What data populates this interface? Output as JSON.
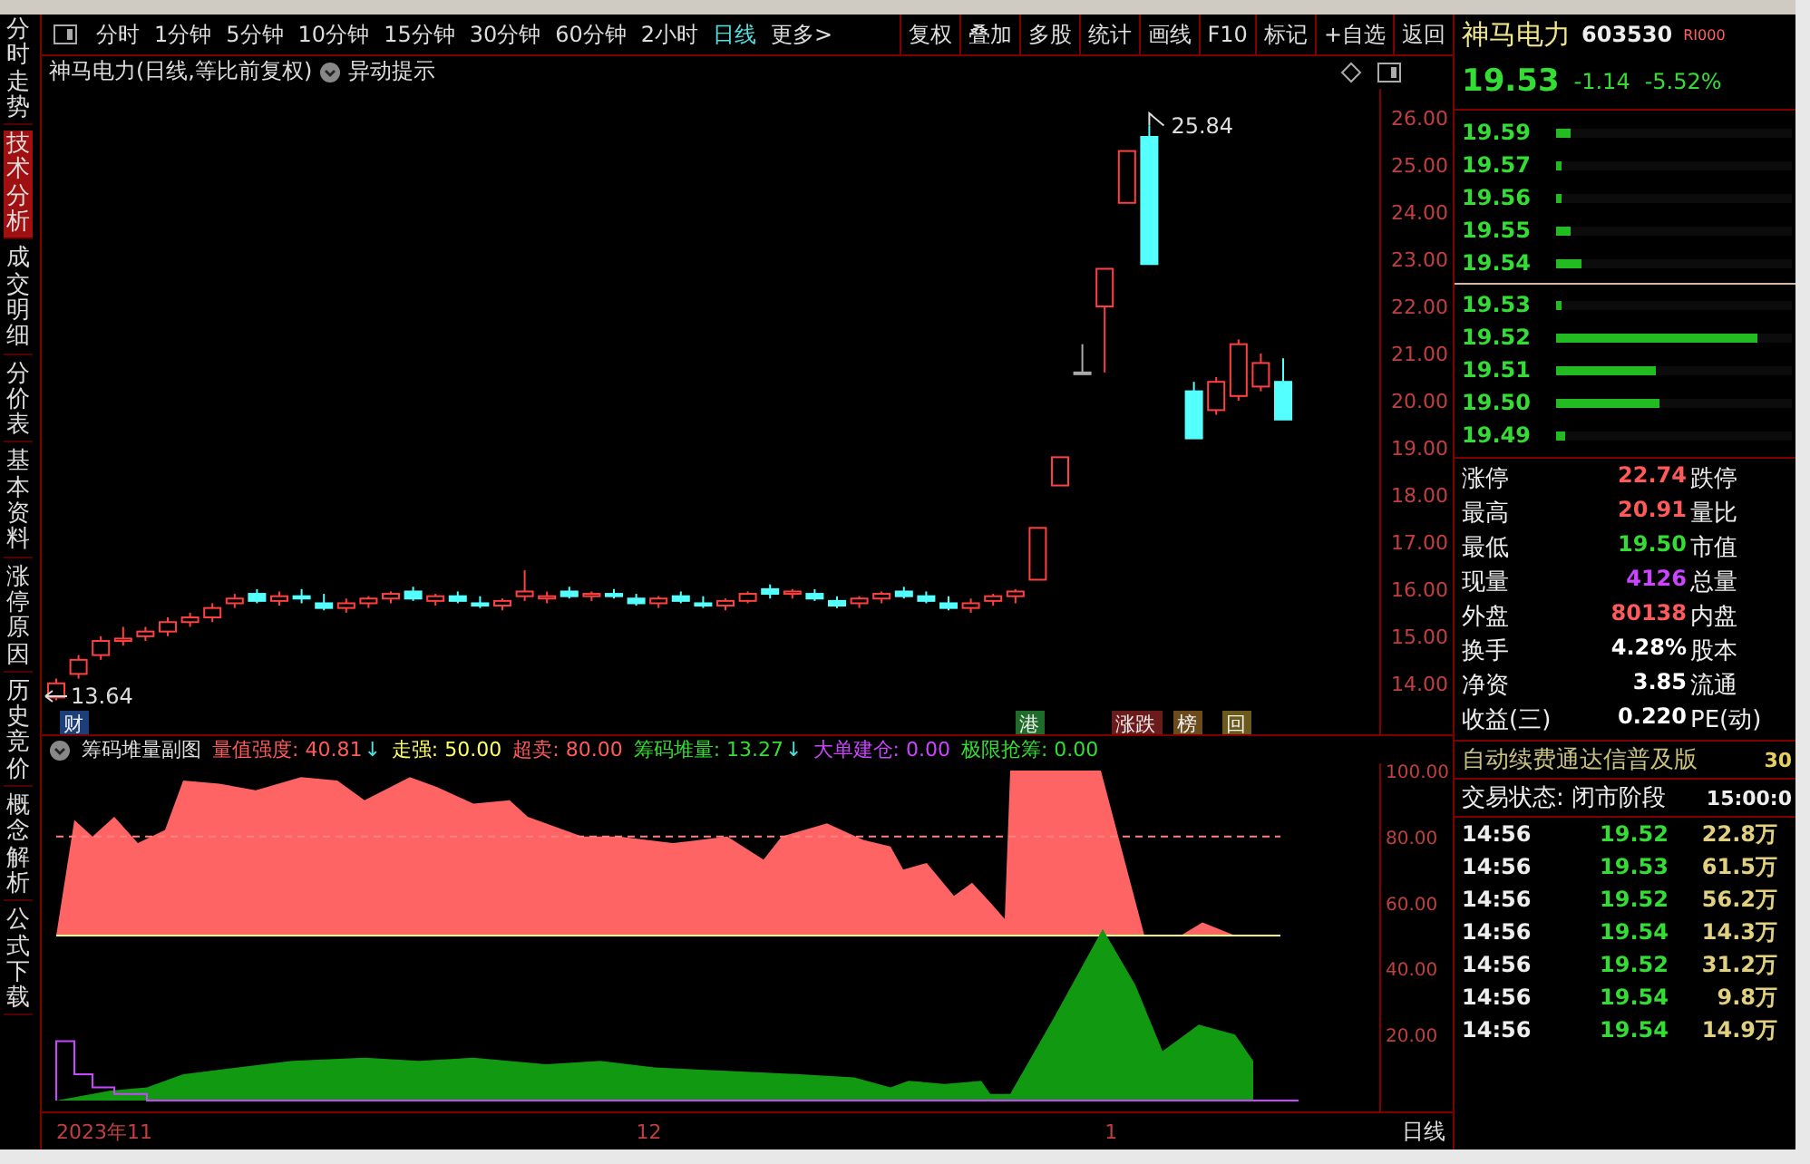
{
  "side_tabs": [
    {
      "label": "分时走势",
      "selected": false
    },
    {
      "label": "技术分析",
      "selected": true
    },
    {
      "label": "成交明细",
      "selected": false
    },
    {
      "label": "分价表",
      "selected": false
    },
    {
      "label": "基本资料",
      "selected": false
    },
    {
      "label": "涨停原因",
      "selected": false
    },
    {
      "label": "历史竞价",
      "selected": false
    },
    {
      "label": "概念解析",
      "selected": false
    },
    {
      "label": "公式下载",
      "selected": false
    }
  ],
  "period_tabs": [
    {
      "label": "分时",
      "selected": false
    },
    {
      "label": "1分钟",
      "selected": false
    },
    {
      "label": "5分钟",
      "selected": false
    },
    {
      "label": "10分钟",
      "selected": false
    },
    {
      "label": "15分钟",
      "selected": false
    },
    {
      "label": "30分钟",
      "selected": false
    },
    {
      "label": "60分钟",
      "selected": false
    },
    {
      "label": "2小时",
      "selected": false
    },
    {
      "label": "日线",
      "selected": true
    },
    {
      "label": "更多>",
      "selected": false
    }
  ],
  "toolbar_buttons": [
    "复权",
    "叠加",
    "多股",
    "统计",
    "画线",
    "F10",
    "标记",
    "+自选",
    "返回"
  ],
  "chart_header": {
    "title": "神马电力(日线,等比前复权)",
    "toggle": "异动提示"
  },
  "price_chart": {
    "chart_data": {
      "type": "candlestick",
      "ohlc": [
        [
          13.7,
          14.1,
          13.64,
          14.0
        ],
        [
          14.2,
          14.6,
          14.1,
          14.5
        ],
        [
          14.6,
          15.0,
          14.5,
          14.9
        ],
        [
          14.9,
          15.2,
          14.8,
          14.95
        ],
        [
          15.0,
          15.2,
          14.9,
          15.1
        ],
        [
          15.1,
          15.4,
          15.0,
          15.3
        ],
        [
          15.3,
          15.5,
          15.2,
          15.4
        ],
        [
          15.4,
          15.7,
          15.3,
          15.6
        ],
        [
          15.7,
          15.9,
          15.6,
          15.8
        ],
        [
          15.9,
          16.0,
          15.7,
          15.75
        ],
        [
          15.75,
          15.95,
          15.65,
          15.85
        ],
        [
          15.85,
          16.0,
          15.7,
          15.8
        ],
        [
          15.7,
          15.9,
          15.55,
          15.6
        ],
        [
          15.6,
          15.8,
          15.5,
          15.7
        ],
        [
          15.7,
          15.85,
          15.6,
          15.8
        ],
        [
          15.8,
          15.95,
          15.7,
          15.9
        ],
        [
          15.95,
          16.05,
          15.75,
          15.8
        ],
        [
          15.75,
          15.9,
          15.65,
          15.85
        ],
        [
          15.85,
          15.95,
          15.7,
          15.75
        ],
        [
          15.7,
          15.85,
          15.6,
          15.65
        ],
        [
          15.65,
          15.8,
          15.55,
          15.75
        ],
        [
          15.85,
          16.4,
          15.75,
          15.95
        ],
        [
          15.8,
          15.95,
          15.7,
          15.85
        ],
        [
          15.95,
          16.05,
          15.8,
          15.85
        ],
        [
          15.85,
          15.95,
          15.75,
          15.9
        ],
        [
          15.9,
          16.0,
          15.8,
          15.85
        ],
        [
          15.8,
          15.9,
          15.65,
          15.7
        ],
        [
          15.7,
          15.85,
          15.6,
          15.8
        ],
        [
          15.85,
          15.95,
          15.7,
          15.75
        ],
        [
          15.7,
          15.85,
          15.6,
          15.65
        ],
        [
          15.65,
          15.8,
          15.55,
          15.75
        ],
        [
          15.75,
          15.95,
          15.7,
          15.9
        ],
        [
          16.0,
          16.1,
          15.8,
          15.9
        ],
        [
          15.9,
          16.0,
          15.8,
          15.95
        ],
        [
          15.9,
          16.0,
          15.75,
          15.8
        ],
        [
          15.75,
          15.85,
          15.6,
          15.65
        ],
        [
          15.7,
          15.85,
          15.6,
          15.8
        ],
        [
          15.8,
          15.95,
          15.7,
          15.9
        ],
        [
          15.95,
          16.05,
          15.8,
          15.85
        ],
        [
          15.85,
          15.95,
          15.7,
          15.75
        ],
        [
          15.7,
          15.85,
          15.55,
          15.6
        ],
        [
          15.6,
          15.8,
          15.5,
          15.7
        ],
        [
          15.75,
          15.9,
          15.65,
          15.85
        ],
        [
          15.85,
          16.0,
          15.7,
          15.95
        ],
        [
          16.2,
          17.3,
          16.2,
          17.3
        ],
        [
          18.2,
          18.8,
          18.2,
          18.8
        ],
        [
          20.6,
          21.2,
          20.6,
          20.6
        ],
        [
          22.0,
          22.8,
          20.6,
          22.8
        ],
        [
          24.2,
          25.3,
          24.2,
          25.3
        ],
        [
          25.6,
          25.84,
          22.9,
          22.9
        ],
        null,
        [
          20.2,
          20.4,
          19.2,
          19.2
        ],
        [
          19.8,
          20.5,
          19.7,
          20.4
        ],
        [
          20.1,
          21.3,
          20.0,
          21.2
        ],
        [
          20.3,
          21.0,
          20.2,
          20.8
        ],
        [
          20.4,
          20.9,
          19.6,
          19.6
        ]
      ],
      "ylim": [
        12.88,
        26.62
      ],
      "yticks": [
        {
          "value": 26,
          "label": "26.00"
        },
        {
          "value": 25,
          "label": "25.00"
        },
        {
          "value": 24,
          "label": "24.00"
        },
        {
          "value": 23,
          "label": "23.00"
        },
        {
          "value": 22,
          "label": "22.00"
        },
        {
          "value": 21,
          "label": "21.00"
        },
        {
          "value": 20,
          "label": "20.00"
        },
        {
          "value": 19,
          "label": "19.00"
        },
        {
          "value": 18,
          "label": "18.00"
        },
        {
          "value": 17,
          "label": "17.00"
        },
        {
          "value": 16,
          "label": "16.00"
        },
        {
          "value": 15,
          "label": "15.00"
        },
        {
          "value": 14,
          "label": "14.00"
        }
      ]
    }
  },
  "price_marks": {
    "high": "25.84",
    "low": "13.64"
  },
  "event_tags": [
    {
      "label": "财",
      "color": "#1c3f7a"
    },
    {
      "label": "港",
      "color": "#1f6b2a"
    },
    {
      "label": "涨跌",
      "color": "#6b1b1b"
    },
    {
      "label": "榜",
      "color": "#6b4a1b"
    },
    {
      "label": "回",
      "color": "#6b5a1b"
    }
  ],
  "indicator": {
    "title": "筹码堆量副图",
    "values": [
      {
        "label": "量值强度: 40.81",
        "arrow": "↓",
        "color": "#ff5a5a"
      },
      {
        "label": "走强: 50.00",
        "color": "#ffff66"
      },
      {
        "label": "超卖: 80.00",
        "color": "#ff5a5a"
      },
      {
        "label": "筹码堆量: 13.27",
        "arrow": "↓",
        "color": "#33dd33"
      },
      {
        "label": "大单建仓: 0.00",
        "color": "#cc44ff"
      },
      {
        "label": "极限抢筹: 0.00",
        "color": "#33dd33"
      }
    ],
    "axis": [
      "100.00",
      "80.00",
      "60.00",
      "40.00",
      "20.00"
    ]
  },
  "date_axis": [
    "2023年11",
    "12",
    "1"
  ],
  "period_label": "日线",
  "quote": {
    "name": "神马电力",
    "code": "603530",
    "tag": "RI000",
    "price": "19.53",
    "change": "-1.14",
    "percent": "-5.52%"
  },
  "order_book": {
    "asks": [
      {
        "price": "19.59",
        "level": 0.06
      },
      {
        "price": "19.57",
        "level": 0.02
      },
      {
        "price": "19.56",
        "level": 0.02
      },
      {
        "price": "19.55",
        "level": 0.06
      },
      {
        "price": "19.54",
        "level": 0.11
      }
    ],
    "bids": [
      {
        "price": "19.53",
        "level": 0.02
      },
      {
        "price": "19.52",
        "level": 0.85
      },
      {
        "price": "19.51",
        "level": 0.42
      },
      {
        "price": "19.50",
        "level": 0.44
      },
      {
        "price": "19.49",
        "level": 0.04
      }
    ]
  },
  "stats": [
    {
      "label": "涨停",
      "value": "22.74",
      "label2": "跌停",
      "color": "#ff5a5a"
    },
    {
      "label": "最高",
      "value": "20.91",
      "label2": "量比",
      "color": "#ff5a5a"
    },
    {
      "label": "最低",
      "value": "19.50",
      "label2": "市值",
      "color": "#33dd33"
    },
    {
      "label": "现量",
      "value": "4126",
      "label2": "总量",
      "color": "#cc44ff"
    },
    {
      "label": "外盘",
      "value": "80138",
      "label2": "内盘",
      "color": "#ff5a5a"
    },
    {
      "label": "换手",
      "value": "4.28%",
      "label2": "股本",
      "color": "#ffffff"
    },
    {
      "label": "净资",
      "value": "3.85",
      "label2": "流通",
      "color": "#ffffff"
    },
    {
      "label": "收益(三)",
      "value": "0.220",
      "label2": "PE(动)",
      "color": "#ffffff"
    }
  ],
  "promo": {
    "text": "自动续费通达信普及版",
    "value": "30"
  },
  "trade_status": {
    "text": "交易状态: 闭市阶段",
    "time": "15:00:0"
  },
  "trades": [
    {
      "time": "14:56",
      "price": "19.52",
      "volume": "22.8万"
    },
    {
      "time": "14:56",
      "price": "19.53",
      "volume": "61.5万"
    },
    {
      "time": "14:56",
      "price": "19.52",
      "volume": "56.2万"
    },
    {
      "time": "14:56",
      "price": "19.54",
      "volume": "14.3万"
    },
    {
      "time": "14:56",
      "price": "19.52",
      "volume": "31.2万"
    },
    {
      "time": "14:56",
      "price": "19.54",
      "volume": "9.8万"
    },
    {
      "time": "14:56",
      "price": "19.54",
      "volume": "14.9万"
    }
  ]
}
